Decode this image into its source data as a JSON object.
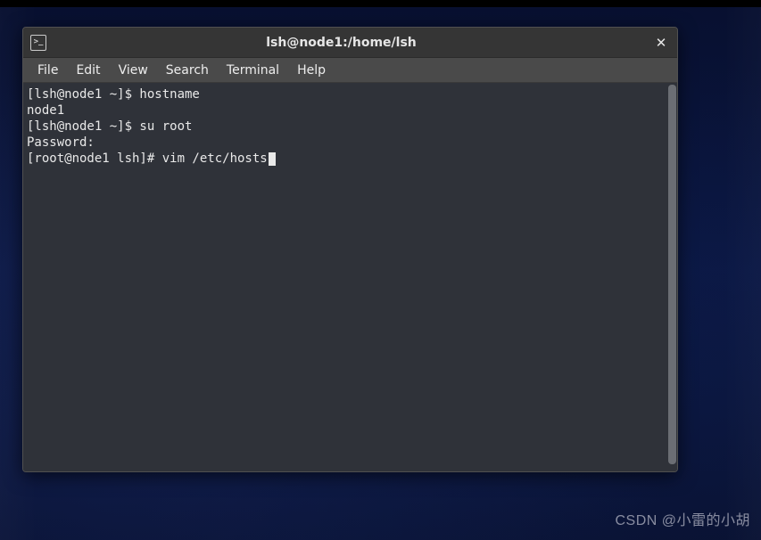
{
  "window": {
    "title": "lsh@node1:/home/lsh"
  },
  "menubar": {
    "items": [
      {
        "label": "File"
      },
      {
        "label": "Edit"
      },
      {
        "label": "View"
      },
      {
        "label": "Search"
      },
      {
        "label": "Terminal"
      },
      {
        "label": "Help"
      }
    ]
  },
  "terminal": {
    "lines": [
      "[lsh@node1 ~]$ hostname",
      "node1",
      "[lsh@node1 ~]$ su root",
      "Password: ",
      "[root@node1 lsh]# vim /etc/hosts"
    ]
  },
  "watermark": "CSDN @小雷的小胡"
}
